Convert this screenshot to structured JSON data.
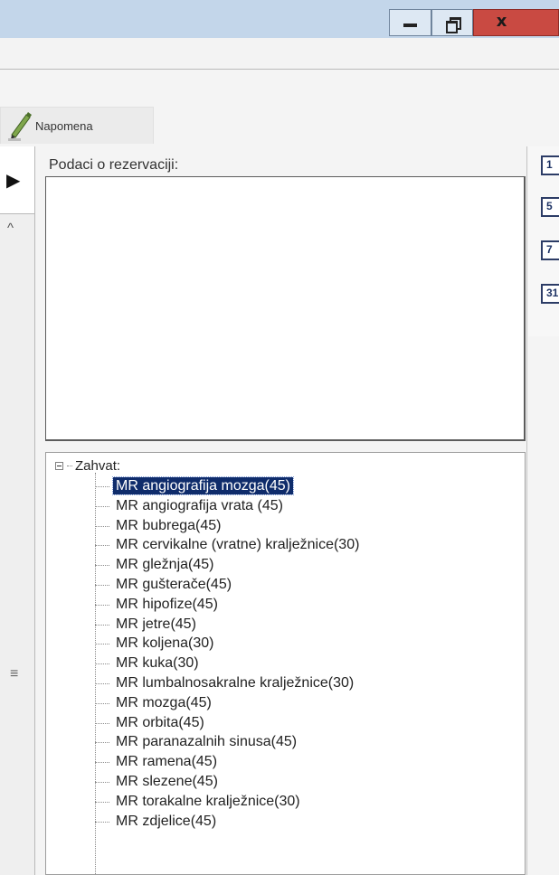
{
  "window": {
    "minimize_icon": "minimize-icon",
    "maximize_icon": "restore-icon",
    "close_icon": "close-icon",
    "close_glyph": "x"
  },
  "tab": {
    "label": "Napomena",
    "icon": "pencil-note-icon"
  },
  "left_strip": {
    "play_glyph": "▶",
    "caret_glyph": "^",
    "menu_glyph": "≡"
  },
  "right_panel": {
    "buttons": [
      "1",
      "5",
      "7",
      "31"
    ]
  },
  "group": {
    "label": "Podaci o rezervaciji:"
  },
  "tree": {
    "root_label": "Zahvat:",
    "selected_index": 0,
    "items": [
      "MR angiografija mozga(45)",
      "MR angiografija vrata (45)",
      "MR bubrega(45)",
      "MR cervikalne (vratne) kralježnice(30)",
      "MR gležnja(45)",
      "MR gušterače(45)",
      "MR hipofize(45)",
      "MR jetre(45)",
      "MR koljena(30)",
      "MR kuka(30)",
      "MR lumbalnosakralne kralježnice(30)",
      "MR mozga(45)",
      "MR orbita(45)",
      "MR paranazalnih sinusa(45)",
      "MR ramena(45)",
      "MR slezene(45)",
      "MR torakalne kralježnice(30)",
      "MR zdjelice(45)"
    ]
  },
  "colors": {
    "titlebar": "#c3d6ea",
    "close_button": "#c94a42",
    "selection": "#0f2c6b"
  }
}
